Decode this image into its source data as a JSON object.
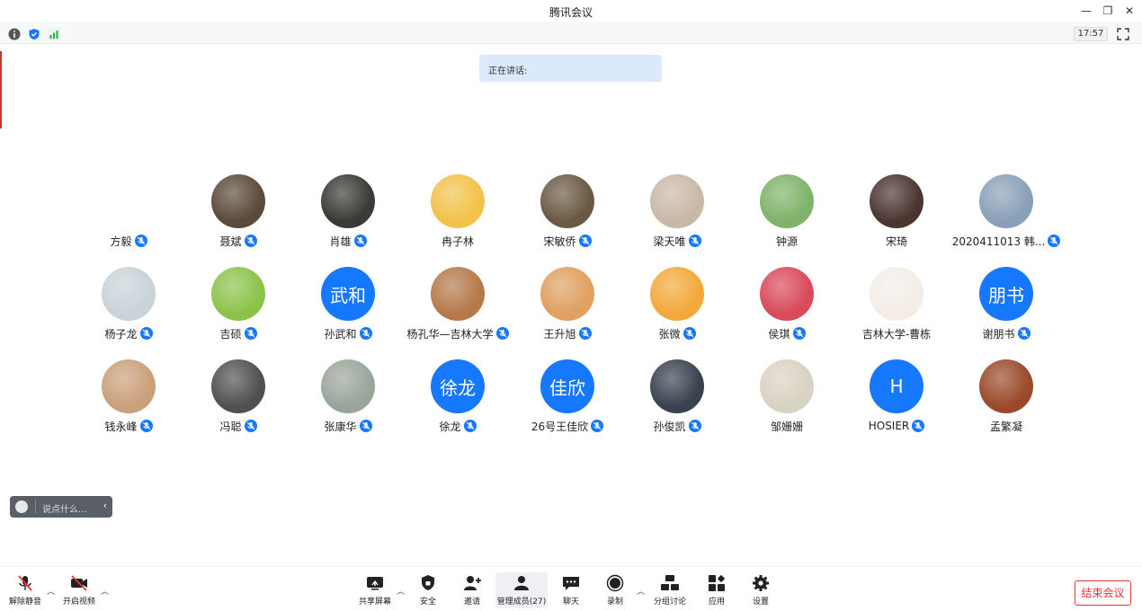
{
  "window": {
    "title": "腾讯会议"
  },
  "infobar": {
    "clock": "17:57"
  },
  "speaking": {
    "label": "正在讲话:"
  },
  "participants": [
    {
      "name": "方毅",
      "type": "img",
      "color": "#ffffff",
      "mic": true
    },
    {
      "name": "聂斌",
      "type": "img",
      "color": "#5b4a3a",
      "mic": true
    },
    {
      "name": "肖雄",
      "type": "img",
      "color": "#3b3a36",
      "mic": true
    },
    {
      "name": "冉子林",
      "type": "img",
      "color": "#f2c24a",
      "mic": false
    },
    {
      "name": "宋敏侨",
      "type": "img",
      "color": "#6a5a44",
      "mic": true
    },
    {
      "name": "梁天唯",
      "type": "img",
      "color": "#c9b8a8",
      "mic": true
    },
    {
      "name": "钟源",
      "type": "img",
      "color": "#7fb36a",
      "mic": false
    },
    {
      "name": "宋琦",
      "type": "img",
      "color": "#4a3530",
      "mic": false
    },
    {
      "name": "2020411013 韩...",
      "type": "img",
      "color": "#8aa0b8",
      "mic": true
    },
    {
      "name": "杨子龙",
      "type": "img",
      "color": "#c9d3d8",
      "mic": true
    },
    {
      "name": "吉硕",
      "type": "img",
      "color": "#8bc34a",
      "mic": true
    },
    {
      "name": "孙武和",
      "type": "text",
      "initials": "武和",
      "color": "#1677ff",
      "mic": true
    },
    {
      "name": "杨孔华—吉林大学",
      "type": "img",
      "color": "#b5794a",
      "mic": true
    },
    {
      "name": "王升旭",
      "type": "img",
      "color": "#e0a060",
      "mic": true
    },
    {
      "name": "张微",
      "type": "img",
      "color": "#f3a83b",
      "mic": true
    },
    {
      "name": "侯琪",
      "type": "img",
      "color": "#d94a5a",
      "mic": true
    },
    {
      "name": "吉林大学-曹栋",
      "type": "img",
      "color": "#f3ede6",
      "mic": false
    },
    {
      "name": "谢朋书",
      "type": "text",
      "initials": "朋书",
      "color": "#1677ff",
      "mic": true
    },
    {
      "name": "钱永峰",
      "type": "img",
      "color": "#caa07a",
      "mic": true
    },
    {
      "name": "冯聪",
      "type": "img",
      "color": "#505050",
      "mic": true
    },
    {
      "name": "张康华",
      "type": "img",
      "color": "#9aa59a",
      "mic": true
    },
    {
      "name": "徐龙",
      "type": "text",
      "initials": "徐龙",
      "color": "#1677ff",
      "mic": true
    },
    {
      "name": "26号王佳欣",
      "type": "text",
      "initials": "佳欣",
      "color": "#1677ff",
      "mic": true
    },
    {
      "name": "孙俊凯",
      "type": "img",
      "color": "#3a4250",
      "mic": true
    },
    {
      "name": "邹姗姗",
      "type": "img",
      "color": "#d8d2c2",
      "mic": false
    },
    {
      "name": "HOSIER",
      "type": "text",
      "initials": "H",
      "color": "#1677ff",
      "mic": true
    },
    {
      "name": "孟繁凝",
      "type": "img",
      "color": "#9a4a2a",
      "mic": false
    }
  ],
  "chat": {
    "placeholder": "说点什么..."
  },
  "toolbar": {
    "unmute": "解除静音",
    "start_video": "开启视频",
    "share": "共享屏幕",
    "security": "安全",
    "invite": "邀请",
    "members": "管理成员(27)",
    "chat": "聊天",
    "record": "录制",
    "breakout": "分组讨论",
    "apps": "应用",
    "settings": "设置",
    "end": "结束会议"
  },
  "colors": {
    "accent": "#1677ff",
    "danger": "#e33333"
  }
}
